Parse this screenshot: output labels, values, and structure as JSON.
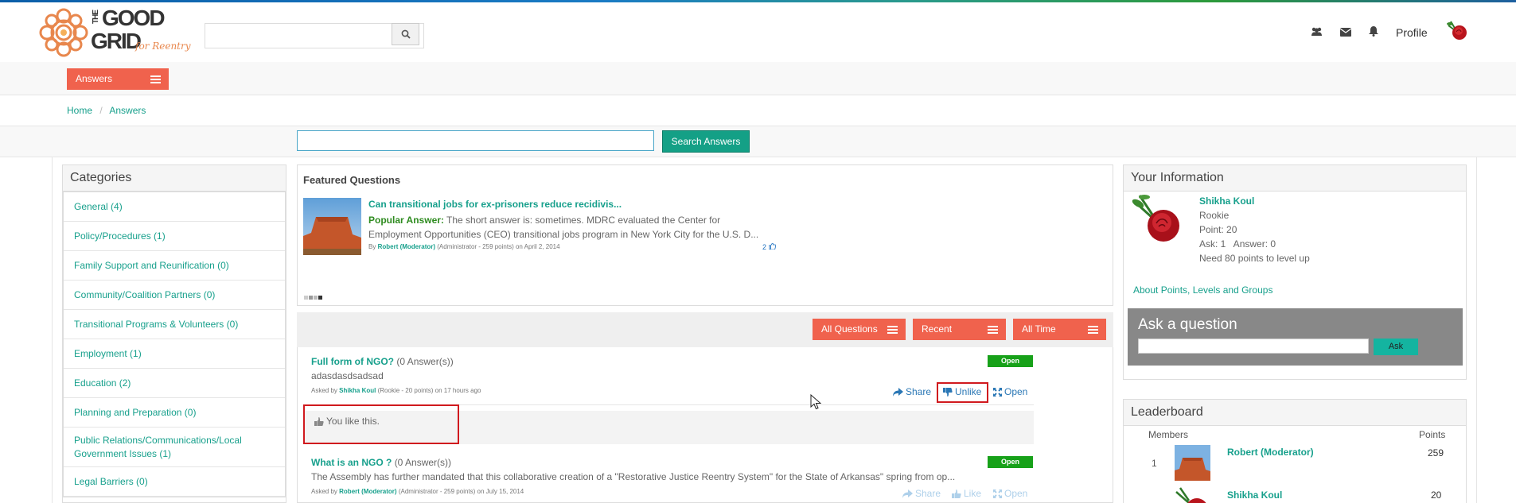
{
  "header": {
    "search_placeholder": "",
    "profile_label": "Profile"
  },
  "logo": {
    "line1": "THE",
    "line2": "GOOD",
    "line3": "GRID",
    "tagline": "for Reentry"
  },
  "nav": {
    "answers_button": "Answers"
  },
  "breadcrumb": {
    "home": "Home",
    "sep": "/",
    "current": "Answers"
  },
  "answer_search": {
    "placeholder": "",
    "button": "Search Answers"
  },
  "categories": {
    "title": "Categories",
    "items": [
      {
        "label": "General (4)"
      },
      {
        "label": "Policy/Procedures (1)"
      },
      {
        "label": "Family Support and Reunification (0)"
      },
      {
        "label": "Community/Coalition Partners (0)"
      },
      {
        "label": "Transitional Programs & Volunteers (0)"
      },
      {
        "label": "Employment (1)"
      },
      {
        "label": "Education (2)"
      },
      {
        "label": "Planning and Preparation (0)"
      },
      {
        "label": "Public Relations/Communications/Local Government Issues (1)"
      },
      {
        "label": "Legal Barriers (0)"
      }
    ]
  },
  "featured": {
    "title": "Featured Questions",
    "question": "Can transitional jobs for ex-prisoners reduce recidivis...",
    "popular_label": "Popular Answer:",
    "answer": " The short answer is: sometimes. MDRC evaluated the Center for Employment Opportunities (CEO) transitional jobs program in New York City for the U.S. D...",
    "by_label": "By",
    "author": "Robert (Moderator)",
    "author_meta": "(Administrator - 259 points)",
    "date": "on April 2, 2014",
    "likes": "2"
  },
  "filters": {
    "all_questions": "All Questions",
    "recent": "Recent",
    "all_time": "All Time"
  },
  "questions": [
    {
      "title": "Full form of NGO?",
      "answers": "(0 Answer(s))",
      "body": "adasdasdsadsad",
      "asked_by": "Asked by",
      "author": "Shikha Koul",
      "author_meta": "(Rookie - 20 points)",
      "time": "on 17 hours ago",
      "status": "Open",
      "share": "Share",
      "like_action": "Unlike",
      "open": "Open",
      "like_note": "You like this."
    },
    {
      "title": "What is an NGO ?",
      "answers": "(0 Answer(s))",
      "body": "The Assembly has further mandated that this collaborative creation of a \"Restorative Justice Reentry System\" for the State of Arkansas\" spring from op...",
      "asked_by": "Asked by",
      "author": "Robert (Moderator)",
      "author_meta": "(Administrator - 259 points)",
      "time": "on July 15, 2014",
      "status": "Open",
      "share": "Share",
      "like_action": "Like",
      "open": "Open"
    }
  ],
  "your_info": {
    "title": "Your Information",
    "name": "Shikha Koul",
    "rank": "Rookie",
    "points": "Point: 20",
    "ask_answer": "Ask: 1   Answer: 0",
    "need": "Need 80 points to level up",
    "link": "About Points, Levels and Groups"
  },
  "ask": {
    "title": "Ask a question",
    "button": "Ask"
  },
  "leaderboard": {
    "title": "Leaderboard",
    "col_members": "Members",
    "col_points": "Points",
    "rows": [
      {
        "rank": "1",
        "name": "Robert (Moderator)",
        "points": "259"
      },
      {
        "rank": "",
        "name": "Shikha Koul",
        "points": "20"
      }
    ]
  },
  "colors": {
    "accent": "#f0624d",
    "link": "#17a08c",
    "button": "#14a086",
    "open_badge": "#17a119"
  }
}
